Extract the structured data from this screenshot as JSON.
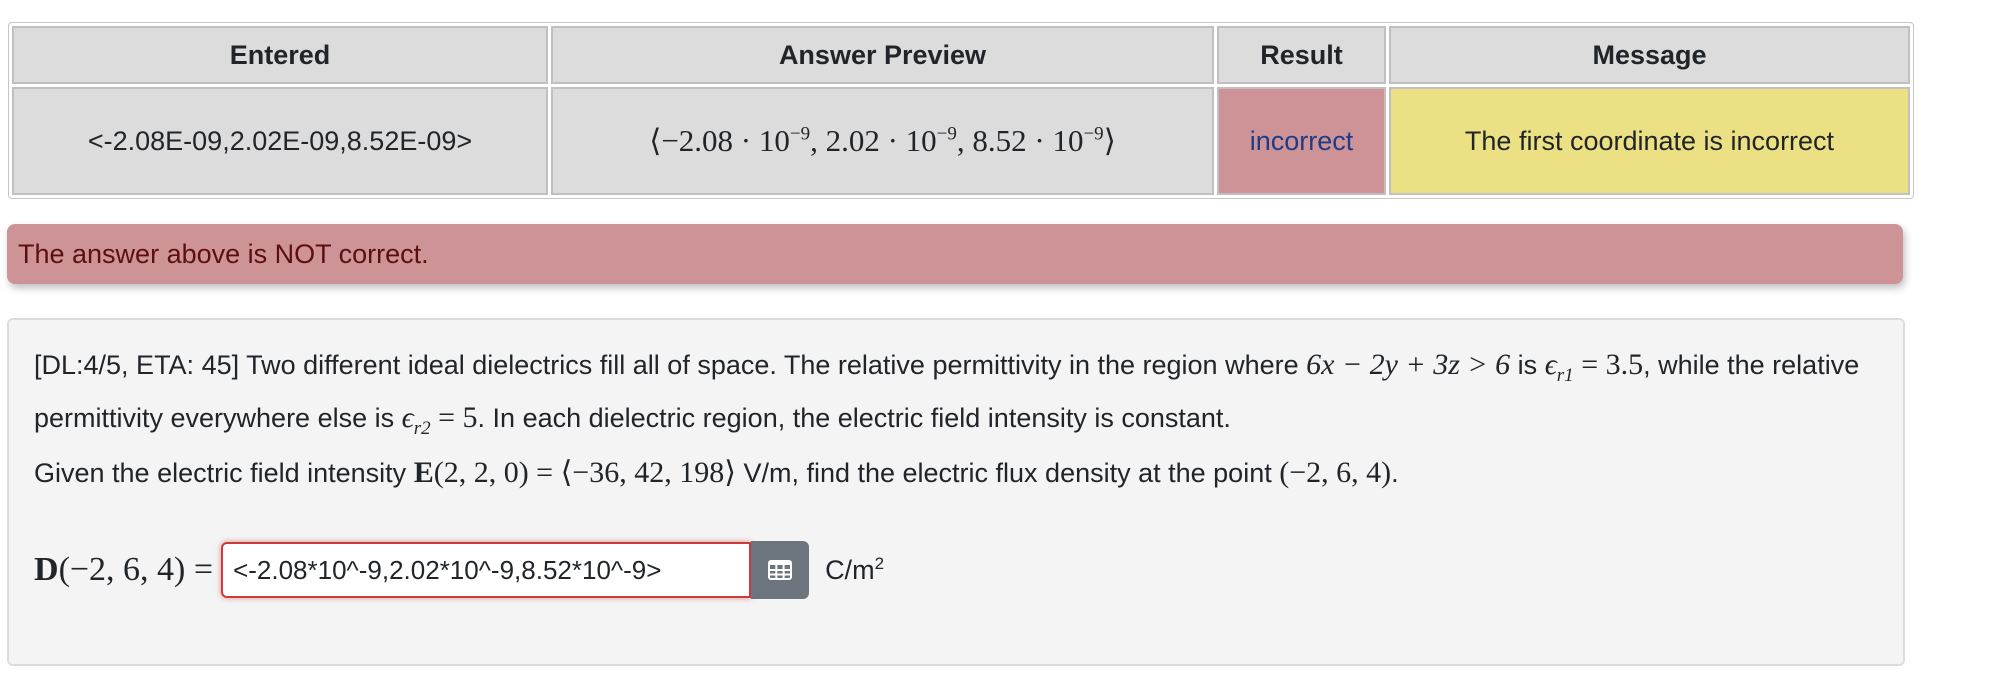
{
  "results_table": {
    "headers": [
      "Entered",
      "Answer Preview",
      "Result",
      "Message"
    ],
    "row": {
      "entered": "<-2.08E-09,2.02E-09,8.52E-09>",
      "preview": {
        "open": "⟨",
        "values": [
          "−2.08 · 10",
          "2.02 · 10",
          "8.52 · 10"
        ],
        "exponent": "−9",
        "close": "⟩"
      },
      "result": "incorrect",
      "message": "The first coordinate is incorrect"
    },
    "colors": {
      "header_bg": "#dcdcdc",
      "incorrect_bg": "#cd9396",
      "message_bg": "#ebe184"
    }
  },
  "alert": {
    "text": "The answer above is NOT correct.",
    "color": "#cd9396"
  },
  "problem": {
    "p1_a": "[DL:4/5, ETA: 45] Two different ideal dielectrics fill all of space. The relative permittivity in the region where ",
    "region_ineq": "6x − 2y + 3z > 6",
    "p1_b": " is ",
    "eps_r1": "ϵ",
    "eps_r1_sub": "r1",
    "eps_r1_val": " = 3.5",
    "p1_c": ", while the relative permittivity everywhere else is ",
    "eps_r2": "ϵ",
    "eps_r2_sub": "r2",
    "eps_r2_val": " = 5",
    "p1_d": ". In each dielectric region, the electric field intensity is constant.",
    "p2_a": "Given the electric field intensity ",
    "E_label": "E",
    "E_args": "(2, 2, 0) = ⟨−36, 42, 198⟩",
    "p2_b": " V/m, find the electric flux density at the point ",
    "point": "(−2, 6, 4)",
    "p2_c": ".",
    "D_label": "D",
    "D_args": "(−2, 6, 4) =",
    "answer_value": "<-2.08*10^-9,2.02*10^-9,8.52*10^-9>",
    "units": "C/m",
    "units_exp": "2",
    "grid_icon": "table-grid-icon"
  }
}
